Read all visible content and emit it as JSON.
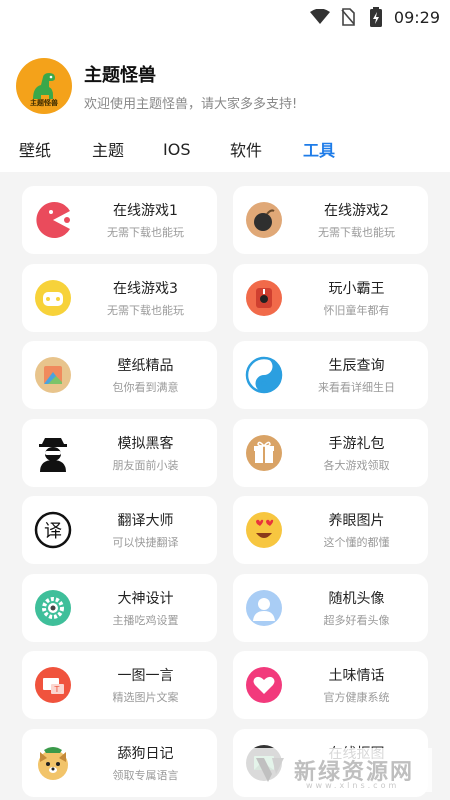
{
  "status_bar": {
    "time": "09:29",
    "icons": [
      "wifi-icon",
      "no-sim-icon",
      "battery-icon"
    ]
  },
  "app": {
    "title": "主题怪兽",
    "subtitle": "欢迎使用主题怪兽，请大家多多支持!",
    "avatar_text": "主题怪兽"
  },
  "tabs": [
    {
      "label": "壁纸",
      "active": false
    },
    {
      "label": "主题",
      "active": false
    },
    {
      "label": "IOS",
      "active": false
    },
    {
      "label": "软件",
      "active": false
    },
    {
      "label": "工具",
      "active": true
    }
  ],
  "accent_color": "#1e7ce8",
  "tools": [
    {
      "title": "在线游戏1",
      "subtitle": "无需下载也能玩",
      "icon": "pacman-icon",
      "color": "#ea4b5c"
    },
    {
      "title": "在线游戏2",
      "subtitle": "无需下载也能玩",
      "icon": "bomb-icon",
      "color": "#e0a877"
    },
    {
      "title": "在线游戏3",
      "subtitle": "无需下载也能玩",
      "icon": "game-controller-icon",
      "color": "#f7d23a"
    },
    {
      "title": "玩小霸王",
      "subtitle": "怀旧童年都有",
      "icon": "retro-console-icon",
      "color": "#f16a4a"
    },
    {
      "title": "壁纸精品",
      "subtitle": "包你看到满意",
      "icon": "wallpaper-icon",
      "color": "#e8c48c"
    },
    {
      "title": "生辰查询",
      "subtitle": "来看看详细生日",
      "icon": "yin-yang-icon",
      "color": "#2b9fe0"
    },
    {
      "title": "模拟黑客",
      "subtitle": "朋友面前小装",
      "icon": "hacker-icon",
      "color": "#111111"
    },
    {
      "title": "手游礼包",
      "subtitle": "各大游戏领取",
      "icon": "gift-icon",
      "color": "#d9a366"
    },
    {
      "title": "翻译大师",
      "subtitle": "可以快捷翻译",
      "icon": "translate-icon",
      "color": "#111111"
    },
    {
      "title": "养眼图片",
      "subtitle": "这个懂的都懂",
      "icon": "heart-eyes-emoji-icon",
      "color": "#f7c640"
    },
    {
      "title": "大神设计",
      "subtitle": "主播吃鸡设置",
      "icon": "settings-gear-icon",
      "color": "#3fbf9a"
    },
    {
      "title": "随机头像",
      "subtitle": "超多好看头像",
      "icon": "user-avatar-icon",
      "color": "#a9cdf5"
    },
    {
      "title": "一图一言",
      "subtitle": "精选图片文案",
      "icon": "image-text-icon",
      "color": "#f0533d"
    },
    {
      "title": "土味情话",
      "subtitle": "官方健康系统",
      "icon": "heart-icon",
      "color": "#f23a7c"
    },
    {
      "title": "舔狗日记",
      "subtitle": "领取专属语言",
      "icon": "dog-icon",
      "color": "#f2c46a"
    },
    {
      "title": "在线抠图",
      "subtitle": "",
      "icon": "cutout-icon",
      "color": "#333333"
    }
  ],
  "watermark": {
    "text": "新绿资源网",
    "url": "www.xlns.com"
  }
}
